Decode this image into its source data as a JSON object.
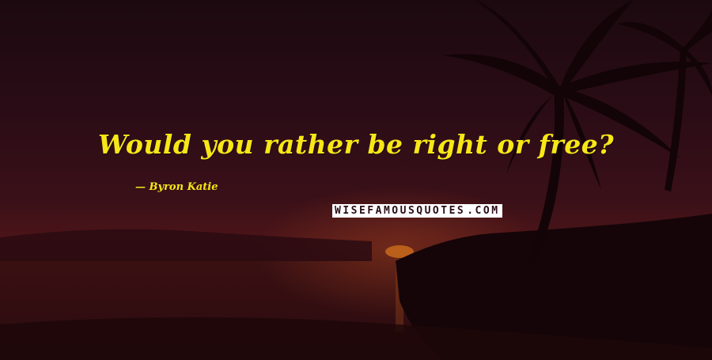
{
  "quote": {
    "text": "Would you rather be right or free?",
    "author": "Byron Katie"
  },
  "watermark": {
    "brand": "WISEFAMOUSQUOTES",
    "tld": ".COM",
    "full": "WISEFAMOUSQUOTES.COM"
  },
  "colors": {
    "quote_text": "#f7e716",
    "background": "#2a0c16",
    "sun": "#c86a1c"
  },
  "icons": {
    "background": "sunset-palm-beach-scene"
  }
}
